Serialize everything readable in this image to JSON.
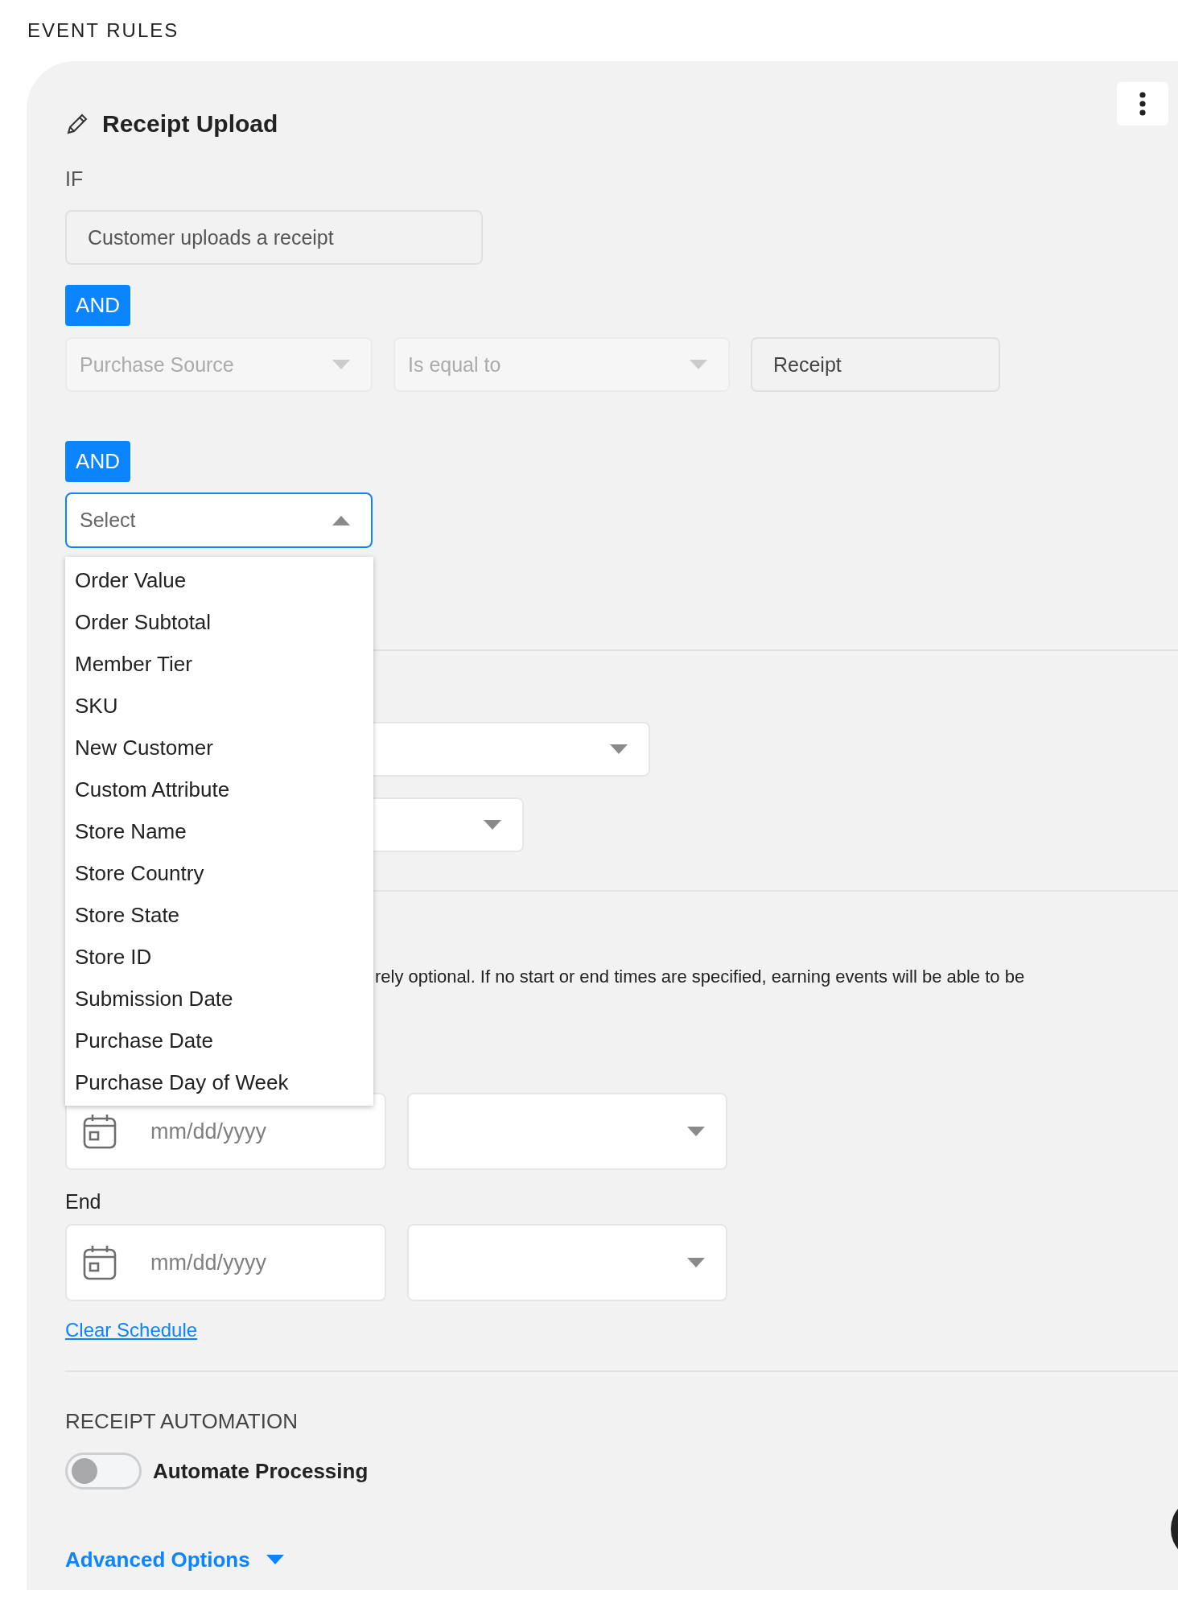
{
  "section_title": "EVENT RULES",
  "rule": {
    "title": "Receipt Upload",
    "if_label": "IF",
    "trigger": {
      "value": "Customer uploads a receipt"
    },
    "conditions": [
      {
        "connector": "AND",
        "field": {
          "placeholder": "Purchase Source",
          "disabled": true
        },
        "operator": {
          "placeholder": "Is equal to",
          "disabled": true
        },
        "value": {
          "value": "Receipt"
        }
      },
      {
        "connector": "AND",
        "field": {
          "placeholder": "Select",
          "expanded": true,
          "options": [
            {
              "label": "Order Value",
              "selected": false
            },
            {
              "label": "Order Subtotal",
              "selected": false
            },
            {
              "label": "Member Tier",
              "selected": false
            },
            {
              "label": "SKU",
              "selected": false
            },
            {
              "label": "New Customer",
              "selected": false
            },
            {
              "label": "Custom Attribute",
              "selected": false
            },
            {
              "label": "Store Name",
              "selected": false
            },
            {
              "label": "Store Country",
              "selected": false
            },
            {
              "label": "Store State",
              "selected": false
            },
            {
              "label": "Store ID",
              "selected": false
            },
            {
              "label": "Submission Date",
              "selected": false
            },
            {
              "label": "Purchase Date",
              "selected": false
            },
            {
              "label": "Purchase Day of Week",
              "selected": false
            }
          ]
        }
      }
    ]
  },
  "schedule": {
    "note": "rely optional. If no start or end times are specified, earning events will be able to be",
    "start": {
      "date": {
        "placeholder": "mm/dd/yyyy"
      }
    },
    "end_label": "End",
    "end": {
      "date": {
        "placeholder": "mm/dd/yyyy"
      }
    },
    "clear_link": "Clear Schedule"
  },
  "automation": {
    "heading": "RECEIPT AUTOMATION",
    "toggle": {
      "label": "Automate Processing",
      "on": false
    }
  },
  "advanced_options": {
    "label": "Advanced Options",
    "expanded": false
  }
}
